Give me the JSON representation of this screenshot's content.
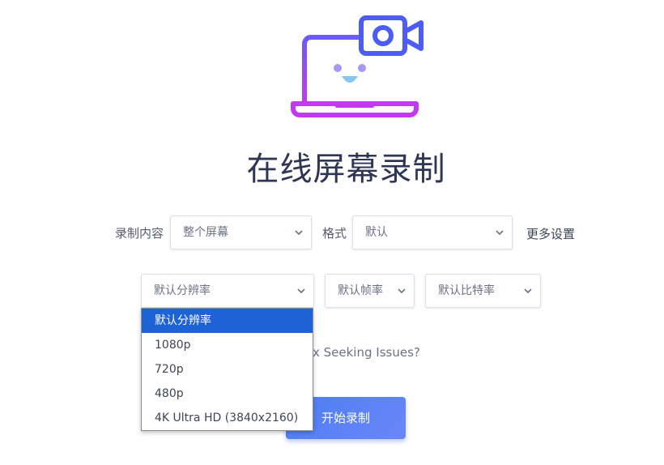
{
  "page": {
    "title": "在线屏幕录制"
  },
  "logo": {
    "icon": "laptop-camera-icon",
    "gradient_start": "#6b5cf5",
    "gradient_end": "#c13af0",
    "camera_color": "#4d5cf5"
  },
  "settings": {
    "content_label": "录制内容",
    "content_value": "整个屏幕",
    "format_label": "格式",
    "format_value": "默认",
    "more_settings": "更多设置",
    "resolution_value": "默认分辨率",
    "framerate_value": "默认帧率",
    "bitrate_value": "默认比特率"
  },
  "resolution_options": [
    "默认分辨率",
    "1080p",
    "720p",
    "480p",
    "4K Ultra HD (3840x2160)"
  ],
  "hint_text": "x Seeking Issues?",
  "start_button": "开始录制",
  "colors": {
    "accent": "#4c7ef4",
    "selected_option": "#1e63d6"
  }
}
